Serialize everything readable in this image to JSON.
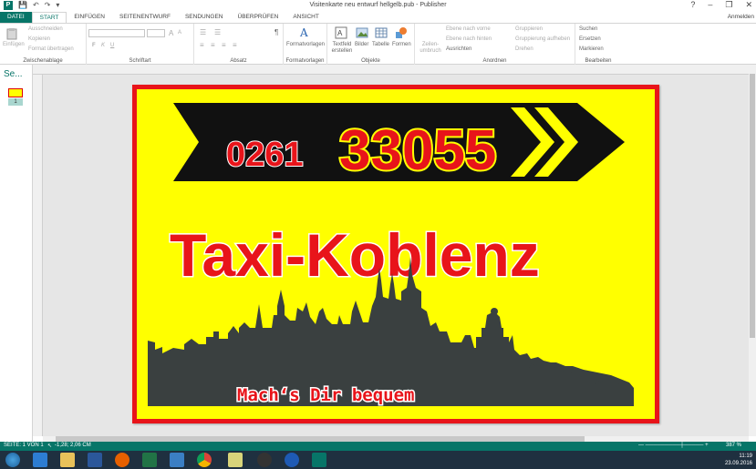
{
  "window": {
    "title": "Visitenkarte neu entwurf hellgelb.pub - Publisher",
    "help": "?",
    "minimize": "–",
    "restore": "❐",
    "close": "✕",
    "signin": "Anmelden"
  },
  "tabs": [
    "DATEI",
    "START",
    "EINFÜGEN",
    "SEITENENTWURF",
    "SENDUNGEN",
    "ÜBERPRÜFEN",
    "ANSICHT"
  ],
  "ribbon": {
    "clipboard": {
      "label": "Zwischenablage",
      "paste": "Einfügen",
      "cut": "Ausschneiden",
      "copy": "Kopieren",
      "format_painter": "Format übertragen"
    },
    "font": {
      "label": "Schriftart",
      "bold": "F",
      "italic": "K",
      "underline": "U",
      "grow": "A",
      "shrink": "A"
    },
    "paragraph": {
      "label": "Absatz",
      "pilcrow": "¶"
    },
    "styles": {
      "label": "Formatvorlagen",
      "button": "Formatvorlagen"
    },
    "objects": {
      "label": "Objekte",
      "textbox": "Textfeld erstellen",
      "pictures": "Bilder",
      "table": "Tabelle",
      "shapes": "Formen"
    },
    "arrange": {
      "label": "Anordnen",
      "wrap": "Zeilen-umbruch",
      "bring_forward": "Ebene nach vorne",
      "send_backward": "Ebene nach hinten",
      "align": "Ausrichten",
      "group": "Gruppieren",
      "ungroup": "Gruppierung aufheben",
      "rotate": "Drehen"
    },
    "editing": {
      "label": "Bearbeiten",
      "find": "Suchen",
      "replace": "Ersetzen",
      "select": "Markieren"
    }
  },
  "pages_panel": {
    "title": "Se...",
    "page_number": "1"
  },
  "card": {
    "phone_prefix": "0261",
    "phone_number": "33055",
    "title": "Taxi-Koblenz",
    "slogan": "Mach‘s Dir bequem",
    "colors": {
      "background": "#ffff00",
      "border": "#e8141a",
      "arrow": "#111111",
      "text_red": "#e8141a",
      "skyline": "#3a4040"
    }
  },
  "status": {
    "page": "SEITE: 1 VON 1",
    "position": "-1,28; 2,06 CM",
    "zoom": "387 %"
  },
  "taskbar": {
    "time": "11:19",
    "date": "23.09.2016"
  }
}
